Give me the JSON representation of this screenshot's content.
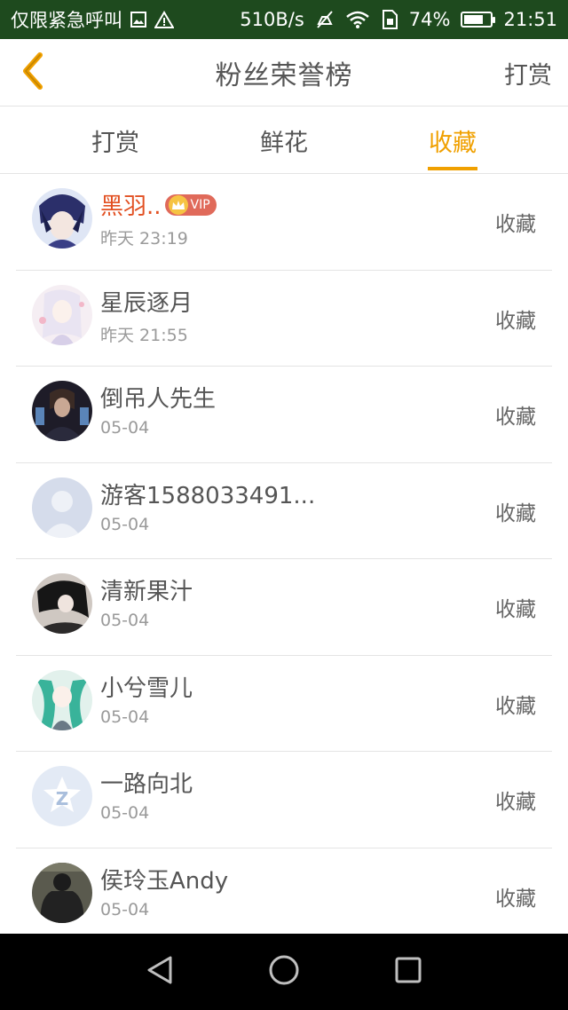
{
  "status_bar": {
    "carrier": "仅限紧急呼叫",
    "speed": "510B/s",
    "battery_percent": "74%",
    "battery_level": 0.74,
    "time": "21:51",
    "icons": [
      "image-icon",
      "warning-icon",
      "mute-icon",
      "wifi-icon",
      "sim-icon",
      "battery-icon"
    ]
  },
  "header": {
    "title": "粉丝荣誉榜",
    "action": "打赏",
    "back_icon": "chevron-left-icon"
  },
  "tabs": [
    {
      "label": "打赏",
      "active": false
    },
    {
      "label": "鲜花",
      "active": false
    },
    {
      "label": "收藏",
      "active": true
    }
  ],
  "accent_color": "#f0a000",
  "list": [
    {
      "name": "黑羽..",
      "time": "昨天 23:19",
      "action": "收藏",
      "vip": true,
      "vip_label": "VIP"
    },
    {
      "name": "星辰逐月",
      "time": "昨天 21:55",
      "action": "收藏",
      "vip": false
    },
    {
      "name": "倒吊人先生",
      "time": "05-04",
      "action": "收藏",
      "vip": false
    },
    {
      "name": "游客1588033491...",
      "time": "05-04",
      "action": "收藏",
      "vip": false
    },
    {
      "name": "清新果汁",
      "time": "05-04",
      "action": "收藏",
      "vip": false
    },
    {
      "name": "小兮雪儿",
      "time": "05-04",
      "action": "收藏",
      "vip": false
    },
    {
      "name": "一路向北",
      "time": "05-04",
      "action": "收藏",
      "vip": false
    },
    {
      "name": "侯玲玉Andy",
      "time": "05-04",
      "action": "收藏",
      "vip": false
    }
  ],
  "nav_bar": {
    "icons": [
      "back-triangle-icon",
      "home-circle-icon",
      "recents-square-icon"
    ]
  }
}
